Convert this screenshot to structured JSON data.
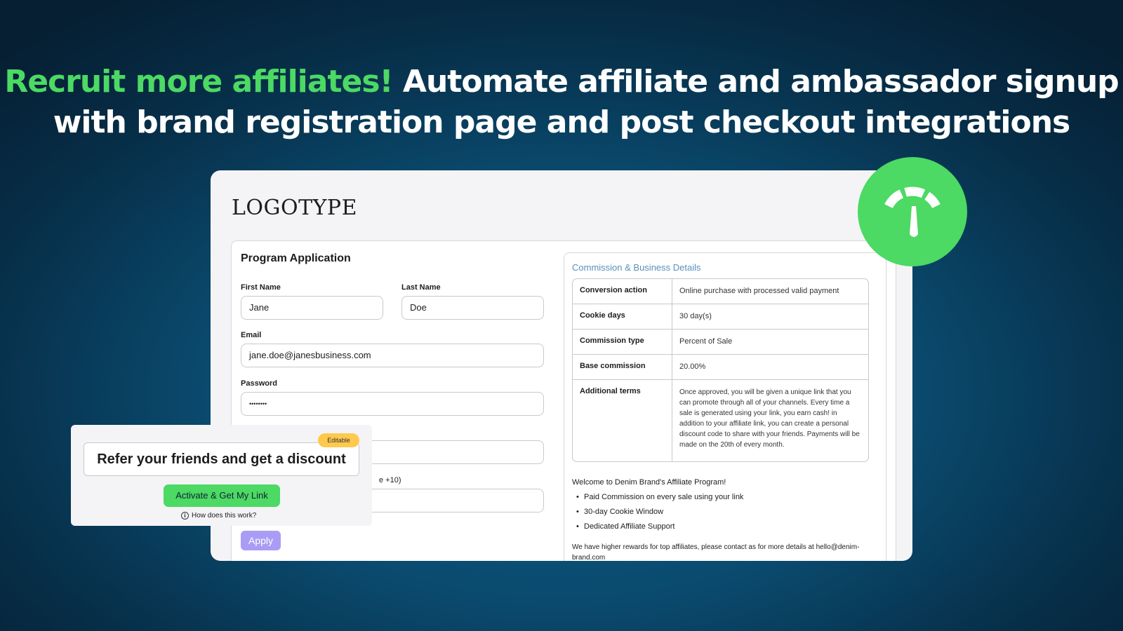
{
  "headline": {
    "highlight": "Recruit more affiliates!",
    "rest_line1": "Automate affiliate and ambassador signup",
    "line2": "with brand registration page and post checkout integrations"
  },
  "colors": {
    "accent_green": "#4cd964",
    "apply_purple": "#a99cf5",
    "badge_yellow": "#ffc94d",
    "details_title": "#5b8fb8"
  },
  "brand": {
    "logotype": "LOGOTYPE"
  },
  "form": {
    "title": "Program Application",
    "first_name_label": "First Name",
    "first_name_value": "Jane",
    "last_name_label": "Last Name",
    "last_name_value": "Doe",
    "email_label": "Email",
    "email_value": "jane.doe@janesbusiness.com",
    "password_label": "Password",
    "password_value": "••••••••",
    "partial_label": "e +10)",
    "apply_label": "Apply"
  },
  "details": {
    "title": "Commission & Business Details",
    "rows": [
      {
        "key": "Conversion action",
        "value": "Online purchase with processed valid payment"
      },
      {
        "key": "Cookie days",
        "value": "30 day(s)"
      },
      {
        "key": "Commission type",
        "value": "Percent of Sale"
      },
      {
        "key": "Base commission",
        "value": "20.00%"
      },
      {
        "key": "Additional terms",
        "value": "Once approved, you will be given a unique link that you can promote through all of your channels. Every time a sale is generated using your link, you earn cash! in addition to your affiliate link, you can create a personal discount code to share with your friends. Payments will be made on the 20th of every month."
      }
    ],
    "welcome": "Welcome to Denim Brand's Affiliate Program!",
    "bullets": [
      "Paid Commission on every sale using your link",
      "30-day Cookie Window",
      "Dedicated Affiliate Support"
    ],
    "contact": "We have higher rewards for top affiliates, please contact as for more details at hello@denim-brand.com"
  },
  "refer": {
    "badge": "Editable",
    "text": "Refer your friends and get a discount",
    "button": "Activate & Get My Link",
    "help": "How does this work?"
  },
  "icons": {
    "gauge": "gauge-icon",
    "info": "info-icon"
  }
}
